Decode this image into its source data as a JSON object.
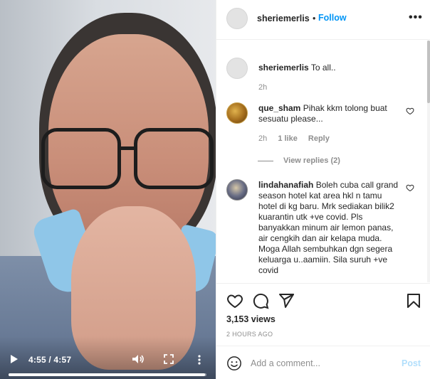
{
  "video": {
    "time_display": "4:55 / 4:57",
    "progress_fraction": 0.993,
    "controls": {
      "play_icon": "play-icon",
      "volume_icon": "volume-icon",
      "fullscreen_icon": "fullscreen-icon",
      "more_icon": "more-vertical-icon"
    }
  },
  "header": {
    "username": "sheriemerlis",
    "separator": "•",
    "follow_label": "Follow",
    "more_label": "•••"
  },
  "caption": {
    "username": "sheriemerlis",
    "text": "To all..",
    "time": "2h"
  },
  "comments": [
    {
      "username": "que_sham",
      "text": "Pihak kkm tolong buat sesuatu please...",
      "time": "2h",
      "likes": "1 like",
      "reply_label": "Reply",
      "view_replies": "View replies (2)"
    },
    {
      "username": "lindahanafiah",
      "text": "Boleh cuba call grand season hotel kat area hkl n tamu hotel di kg baru. Mrk sediakan bilik2 kuarantin utk +ve covid. Pls banyakkan minum air lemon panas, air cengkih dan air kelapa muda. Moga Allah sembuhkan dgn segera keluarga u..aamiin. Sila suruh +ve covid"
    }
  ],
  "actions": {
    "like_icon": "heart-icon",
    "comment_icon": "comment-icon",
    "share_icon": "share-icon",
    "save_icon": "bookmark-icon"
  },
  "stats": {
    "views": "3,153 views",
    "posted_ago": "2 HOURS AGO"
  },
  "add_comment": {
    "placeholder": "Add a comment...",
    "post_label": "Post",
    "emoji_icon": "emoji-icon"
  },
  "colors": {
    "accent": "#0095f6",
    "post_disabled": "#b2dffc",
    "muted": "#8e8e8e",
    "text": "#262626"
  }
}
